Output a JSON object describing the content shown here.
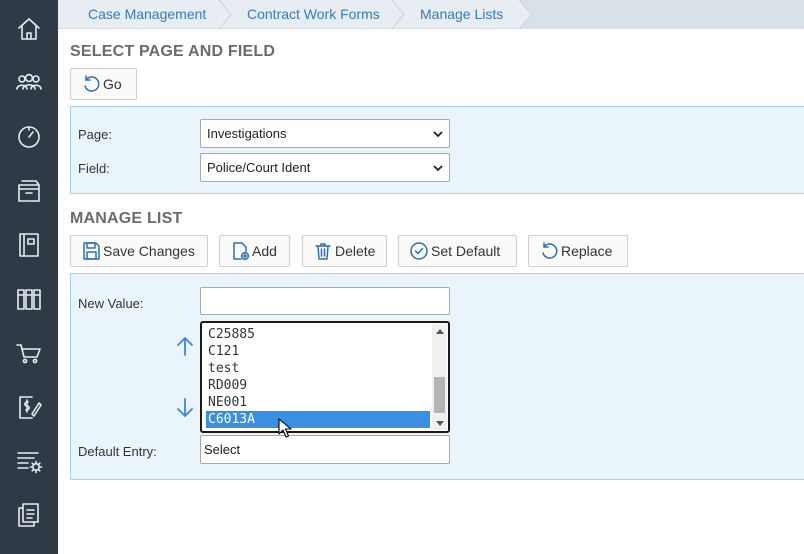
{
  "sidebar": {
    "items": [
      {
        "name": "home-icon"
      },
      {
        "name": "people-icon"
      },
      {
        "name": "dashboard-gauge-icon"
      },
      {
        "name": "archive-box-icon"
      },
      {
        "name": "notebook-icon"
      },
      {
        "name": "books-icon"
      },
      {
        "name": "shopping-cart-icon"
      },
      {
        "name": "invoice-edit-icon"
      },
      {
        "name": "list-settings-icon"
      },
      {
        "name": "documents-icon"
      }
    ]
  },
  "breadcrumb": {
    "items": [
      "Case Management",
      "Contract Work Forms",
      "Manage Lists"
    ]
  },
  "select_section": {
    "title": "SELECT PAGE AND FIELD",
    "go_label": "Go",
    "page_label": "Page:",
    "page_value": "Investigations",
    "field_label": "Field:",
    "field_value": "Police/Court Ident"
  },
  "manage_section": {
    "title": "MANAGE LIST",
    "buttons": {
      "save": "Save Changes",
      "add": "Add",
      "delete": "Delete",
      "set_default": "Set Default",
      "replace": "Replace"
    },
    "new_value_label": "New Value:",
    "new_value": "",
    "list_options": [
      "C25885",
      "C121",
      "test",
      "RD009",
      "NE001",
      "C6013A"
    ],
    "selected_option": "C6013A",
    "default_entry_label": "Default Entry:",
    "default_entry_value": "Select"
  },
  "colors": {
    "sidebar_bg": "#2e3b46",
    "accent": "#3a7ab8",
    "panel_bg": "#eaf4fb",
    "selected_bg": "#3b8fe0"
  }
}
